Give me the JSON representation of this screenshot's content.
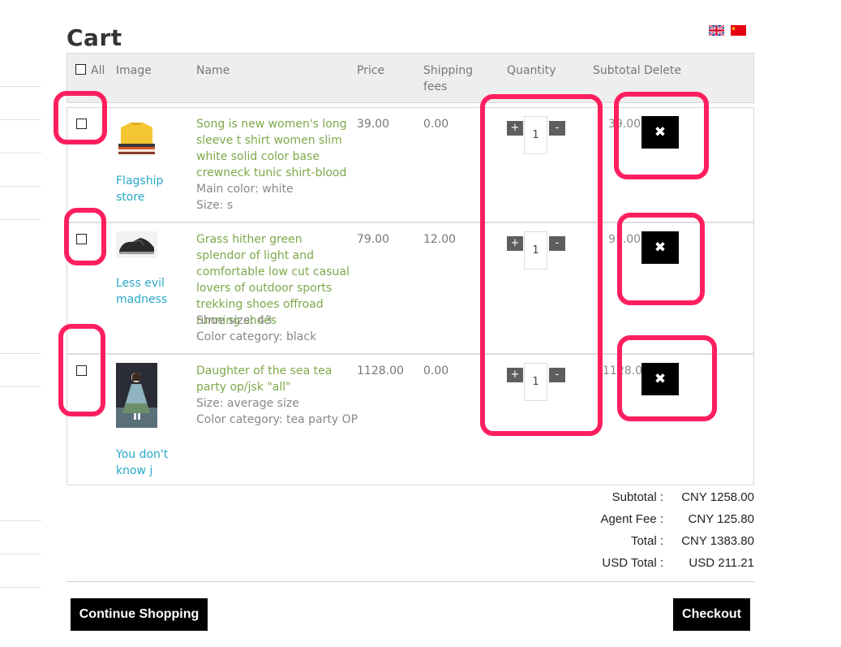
{
  "page_title": "Cart",
  "languages": [
    {
      "code": "en",
      "icon": "uk-flag-icon"
    },
    {
      "code": "zh",
      "icon": "china-flag-icon"
    }
  ],
  "table": {
    "headers": {
      "all": "All",
      "image": "Image",
      "name": "Name",
      "price": "Price",
      "shipping": "Shipping fees",
      "quantity": "Quantity",
      "subtotal": "Subtotal",
      "delete": "Delete"
    },
    "rows": [
      {
        "store": "Flagship store",
        "name": "Song is new women's long sleeve t shirt women slim white solid color base crewneck tunic shirt-blood",
        "attrs": [
          "Main color: white",
          "Size: s"
        ],
        "price": "39.00",
        "shipping": "0.00",
        "quantity": "1",
        "subtotal": "39.00",
        "image_icon": "folded-shirts-image"
      },
      {
        "store": "Less evil madness",
        "name": "Grass hither green splendor of light and comfortable low cut casual lovers of outdoor sports trekking shoes offroad running shoes",
        "attrs": [
          "Shoe size: 43",
          "Color category: black"
        ],
        "price": "79.00",
        "shipping": "12.00",
        "quantity": "1",
        "subtotal": "91.00",
        "image_icon": "sneaker-image"
      },
      {
        "store": "You don't know j",
        "name": "Daughter of the sea tea party op/jsk \"all\"",
        "attrs": [
          "Size: average size",
          "Color category: tea party OP"
        ],
        "price": "1128.00",
        "shipping": "0.00",
        "quantity": "1",
        "subtotal": "1128.00",
        "image_icon": "dress-photo-image"
      }
    ],
    "qty_plus": "+",
    "qty_minus": "-",
    "delete_glyph": "✖"
  },
  "totals": [
    {
      "label": "Subtotal :",
      "value": "CNY 1258.00"
    },
    {
      "label": "Agent Fee :",
      "value": "CNY 125.80"
    },
    {
      "label": "Total :",
      "value": "CNY 1383.80"
    },
    {
      "label": "USD Total :",
      "value": "USD 211.21"
    }
  ],
  "buttons": {
    "continue": "Continue Shopping",
    "checkout": "Checkout"
  },
  "colors": {
    "highlight": "#ff1f5f",
    "link": "#29a8c9",
    "product_name": "#7da84a",
    "button_bg": "#000000"
  }
}
